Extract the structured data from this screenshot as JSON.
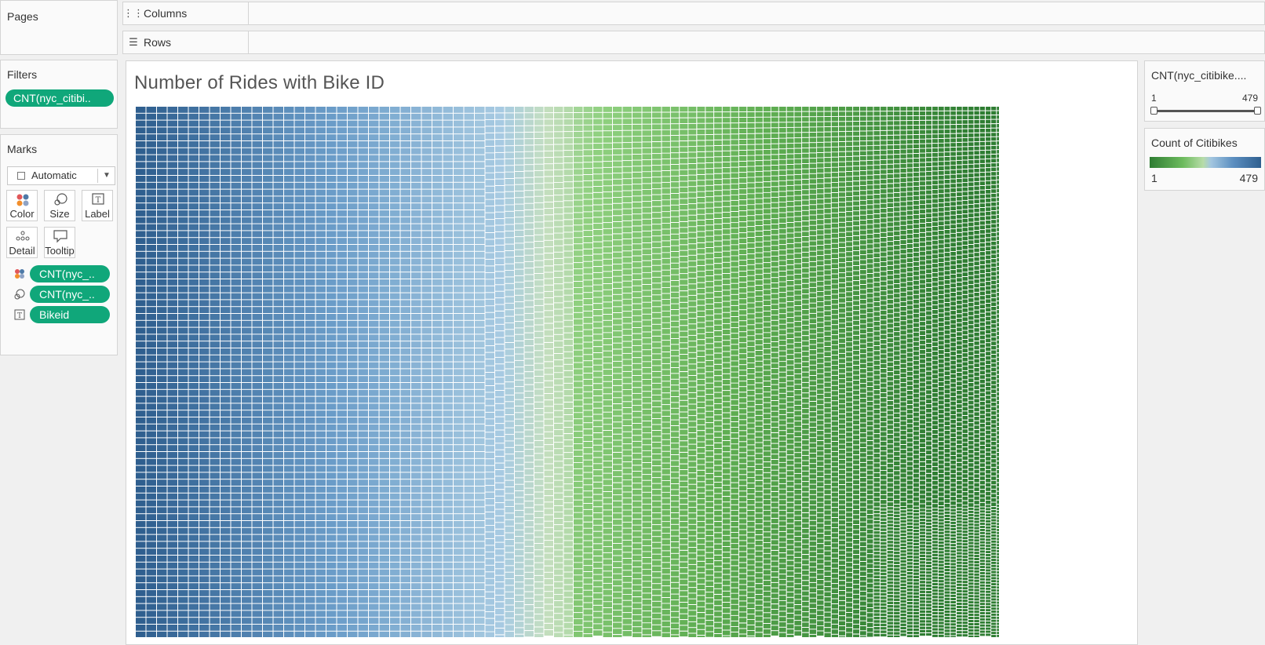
{
  "pages": {
    "title": "Pages"
  },
  "shelves": {
    "columns": {
      "label": "Columns",
      "icon": "columns-icon"
    },
    "rows": {
      "label": "Rows",
      "icon": "rows-icon"
    }
  },
  "filters": {
    "title": "Filters",
    "pills": [
      {
        "label": "CNT(nyc_citibi.."
      }
    ]
  },
  "marks": {
    "title": "Marks",
    "mark_type": "Automatic",
    "buttons": [
      {
        "label": "Color",
        "icon": "color-icon"
      },
      {
        "label": "Size",
        "icon": "size-icon"
      },
      {
        "label": "Label",
        "icon": "label-icon"
      },
      {
        "label": "Detail",
        "icon": "detail-icon"
      },
      {
        "label": "Tooltip",
        "icon": "tooltip-icon"
      }
    ],
    "cards": [
      {
        "icon": "color-icon",
        "label": "CNT(nyc_.."
      },
      {
        "icon": "size-icon",
        "label": "CNT(nyc_.."
      },
      {
        "icon": "label-icon",
        "label": "Bikeid"
      }
    ]
  },
  "viz": {
    "title": "Number of Rides with Bike ID"
  },
  "filter_card": {
    "title": "CNT(nyc_citibike....",
    "min_label": "1",
    "max_label": "479",
    "range": [
      1,
      479
    ]
  },
  "legend": {
    "title": "Count of Citibikes",
    "min_label": "1",
    "max_label": "479",
    "colors": {
      "low": "#2e7d32",
      "mid_green": "#8cd17d",
      "mid_blue": "#a3c6e0",
      "high": "#2f5f8f"
    }
  },
  "chart_data": {
    "type": "heatmap",
    "title": "Number of Rides with Bike ID",
    "color_range": [
      1,
      479
    ],
    "description_encoding": "treemap of bike IDs sized and colored by ride count"
  }
}
